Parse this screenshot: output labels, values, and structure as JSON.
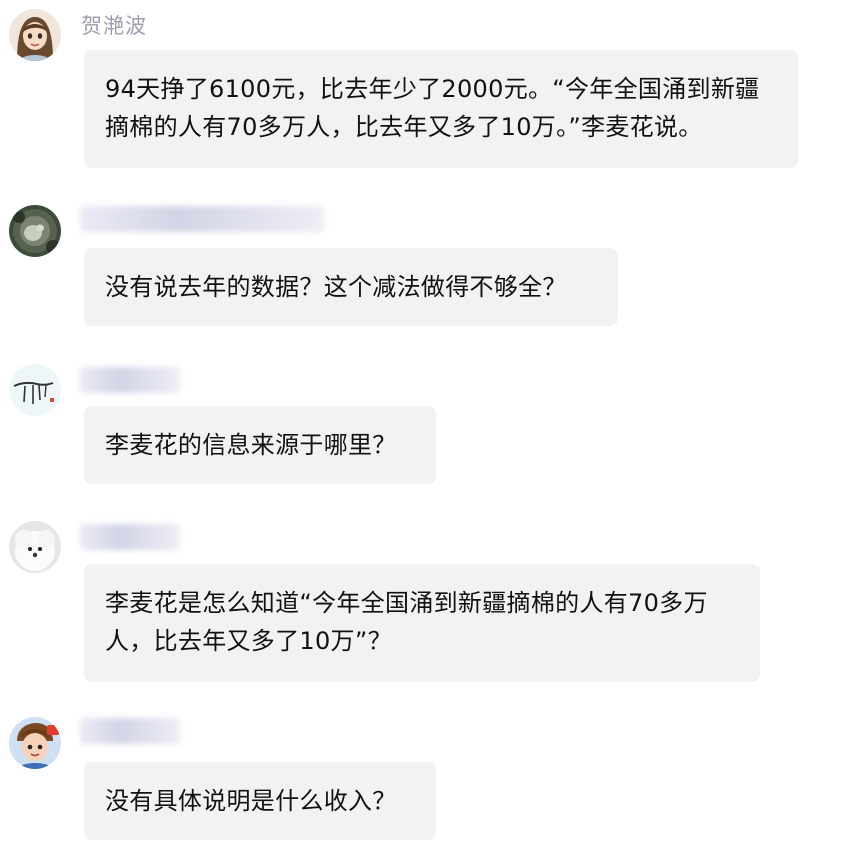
{
  "messages": [
    {
      "sender": "贺滟波",
      "text": "94天挣了6100元，比去年少了2000元。“今年全国涌到新疆摘棉的人有70多万人，比去年又多了10万。”李麦花说。",
      "avatar": "woman-cartoon-avatar"
    },
    {
      "sender": "",
      "text": "没有说去年的数据？这个减法做得不够全？",
      "avatar": "dark-photo-avatar"
    },
    {
      "sender": "",
      "text": "李麦花的信息来源于哪里？",
      "avatar": "ink-sketch-avatar"
    },
    {
      "sender": "",
      "text": "李麦花是怎么知道“今年全国涌到新疆摘棉的人有70多万人，比去年又多了10万”？",
      "avatar": "white-dog-avatar"
    },
    {
      "sender": "",
      "text": "没有具体说明是什么收入？",
      "avatar": "cartoon-boy-avatar"
    }
  ],
  "colors": {
    "bubble": "#f2f2f2",
    "sender_name": "#9a9eb0",
    "text": "#111111",
    "background": "#ffffff"
  }
}
